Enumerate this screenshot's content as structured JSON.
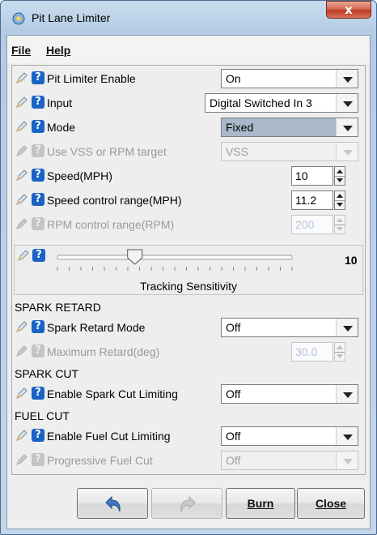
{
  "window": {
    "title": "Pit Lane Limiter",
    "close_glyph": "x"
  },
  "menu": {
    "file": "File",
    "help": "Help"
  },
  "rows": {
    "enable": {
      "label": "Pit Limiter Enable",
      "value": "On"
    },
    "input": {
      "label": "Input",
      "value": "Digital Switched In 3"
    },
    "mode": {
      "label": "Mode",
      "value": "Fixed"
    },
    "vss": {
      "label": "Use VSS or RPM target",
      "value": "VSS"
    },
    "speed": {
      "label": "Speed(MPH)",
      "value": "10"
    },
    "speed_range": {
      "label": "Speed control range(MPH)",
      "value": "11.2"
    },
    "rpm_range": {
      "label": "RPM control range(RPM)",
      "value": "200"
    }
  },
  "slider": {
    "label": "Tracking Sensitivity",
    "value": "10",
    "level_fraction": 0.33
  },
  "spark_retard": {
    "header": "SPARK RETARD",
    "mode_label": "Spark Retard Mode",
    "mode_value": "Off",
    "max_label": "Maximum Retard(deg)",
    "max_value": "30.0"
  },
  "spark_cut": {
    "header": "SPARK CUT",
    "label": "Enable Spark Cut Limiting",
    "value": "Off"
  },
  "fuel_cut": {
    "header": "FUEL CUT",
    "label": "Enable Fuel Cut Limiting",
    "value": "Off",
    "prog_label": "Progressive Fuel Cut",
    "prog_value": "Off"
  },
  "buttons": {
    "undo_icon": "undo-icon",
    "redo_icon": "redo-icon",
    "burn": "Burn",
    "close": "Close"
  },
  "colors": {
    "help_icon": "#1a63c4",
    "selected_combo": "#a9b9c9",
    "close_button": "#c23c22"
  }
}
